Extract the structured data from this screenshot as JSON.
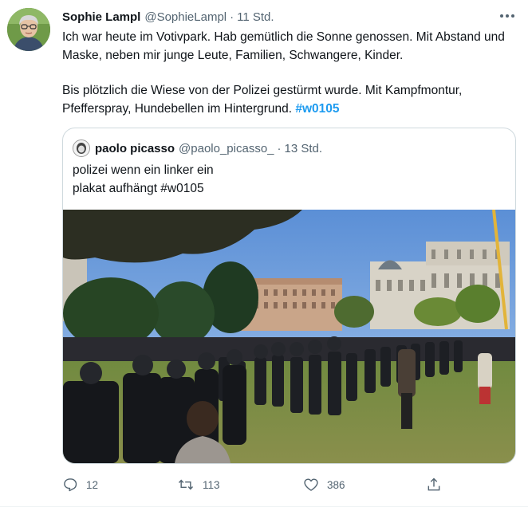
{
  "tweet": {
    "author_name": "Sophie Lampl",
    "author_handle": "@SophieLampl",
    "separator": "·",
    "time": "11 Std.",
    "paragraph1": "Ich war heute im Votivpark. Hab gemütlich die Sonne genossen. Mit Abstand und Maske, neben mir junge Leute, Familien, Schwangere, Kinder.",
    "paragraph2": "Bis plötzlich die Wiese von der Polizei gestürmt wurde. Mit Kampfmontur, Pfefferspray, Hundebellen im Hintergrund.",
    "hashtag": "#w0105"
  },
  "quoted": {
    "author_name": "paolo picasso",
    "author_handle": "@paolo_picasso_",
    "separator": "·",
    "time": "13 Std.",
    "line1": "polizei wenn ein linker ein",
    "line2": "plakat aufhängt #w0105"
  },
  "actions": {
    "reply_count": "12",
    "retweet_count": "113",
    "like_count": "386"
  },
  "icons": {
    "more": "more-horizontal-icon",
    "reply": "reply-icon",
    "retweet": "retweet-icon",
    "like": "heart-icon",
    "share": "share-icon"
  },
  "colors": {
    "accent": "#1d9bf0",
    "text": "#0f1419",
    "secondary": "#536471",
    "border": "#cfd9de"
  }
}
